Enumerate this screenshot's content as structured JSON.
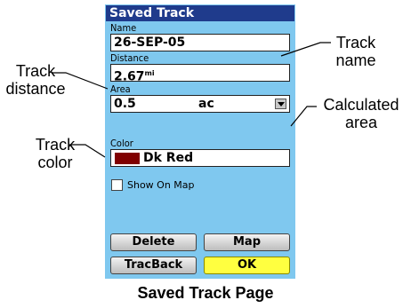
{
  "screen": {
    "title": "Saved Track",
    "name_label": "Name",
    "name_value": "26-SEP-05",
    "distance_label": "Distance",
    "distance_value": "2.67",
    "distance_unit": "mi",
    "area_label": "Area",
    "area_value": "0.5",
    "area_unit": "ac",
    "color_label": "Color",
    "color_value": "Dk Red",
    "color_swatch": "#800000",
    "show_on_map_label": "Show On Map",
    "show_on_map_checked": false,
    "buttons": {
      "delete": "Delete",
      "map": "Map",
      "tracback": "TracBack",
      "ok": "OK"
    }
  },
  "annotations": {
    "track_name": "Track name",
    "track_distance": "Track distance",
    "calculated_area": "Calculated area",
    "track_color": "Track color"
  },
  "caption": "Saved Track Page",
  "colors": {
    "title_bar": "#1f3b8c",
    "screen_bg": "#7fc8ef",
    "ok_button": "#ffff40"
  }
}
